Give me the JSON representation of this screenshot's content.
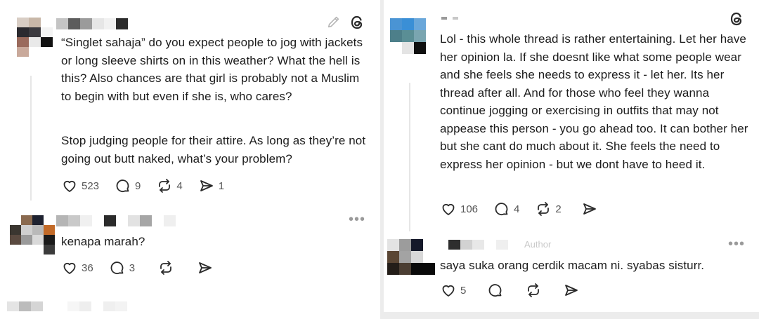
{
  "left": {
    "post": {
      "paragraph1": "“Singlet sahaja” do you expect people to jog with jackets or long sleeve shirts on in this weather? What the hell is this? Also chances are that girl is probably not a Muslim to begin with but even if she is, who cares?",
      "paragraph2": "Stop judging people for their attire. As long as they’re not going out butt naked, what’s your problem?",
      "likes": "523",
      "replies": "9",
      "reposts": "4",
      "shares": "1"
    },
    "reply": {
      "text": "kenapa marah?",
      "likes": "36",
      "replies": "3"
    }
  },
  "right": {
    "post": {
      "text": "Lol - this whole thread is rather entertaining. Let her have her opinion la. If she doesnt like what some people wear and she feels she needs to express it - let her. Its her thread after all. And for those who feel they wanna continue jogging or exercising in outfits that may not appease this person - you go ahead too. It can bother her but she cant do much about it. She feels the need to express her opinion - but we dont have to heed it.",
      "likes": "106",
      "replies": "4",
      "reposts": "2"
    },
    "reply": {
      "author_badge": "Author",
      "text": "saya suka orang cerdik macam ni. syabas sisturr.",
      "likes": "5"
    }
  },
  "icons": {
    "edit": "pencil-icon",
    "threads": "threads-logo-icon",
    "like": "heart-icon",
    "reply": "comment-icon",
    "repost": "repost-icon",
    "share": "send-icon",
    "more": "more-icon"
  },
  "colors": {
    "text": "#1c1c1c",
    "muted": "#555555",
    "icon": "#2a2a2a",
    "background": "#ffffff",
    "divider": "#ececec"
  }
}
